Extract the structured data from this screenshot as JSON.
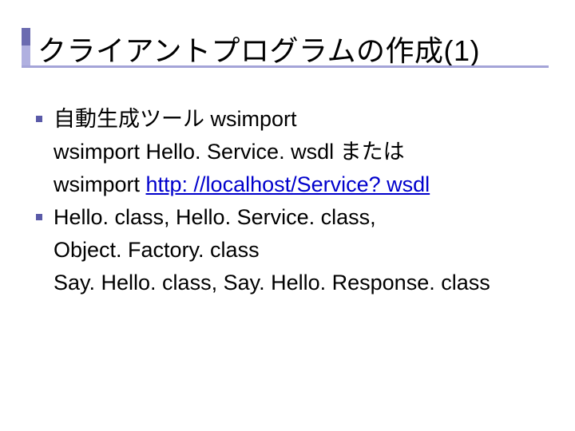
{
  "slide": {
    "title": "クライアントプログラムの作成(1)",
    "items": [
      {
        "lines": [
          {
            "text": "自動生成ツール wsimport"
          },
          {
            "text": "wsimport  Hello. Service. wsdl  または"
          },
          {
            "prefix": "wsimport  ",
            "link": "http: //localhost/Service? wsdl"
          }
        ]
      },
      {
        "lines": [
          {
            "text": " Hello. class, Hello. Service. class,"
          },
          {
            "text": " Object. Factory. class"
          },
          {
            "text": " Say. Hello. class, Say. Hello. Response. class"
          }
        ]
      }
    ]
  }
}
